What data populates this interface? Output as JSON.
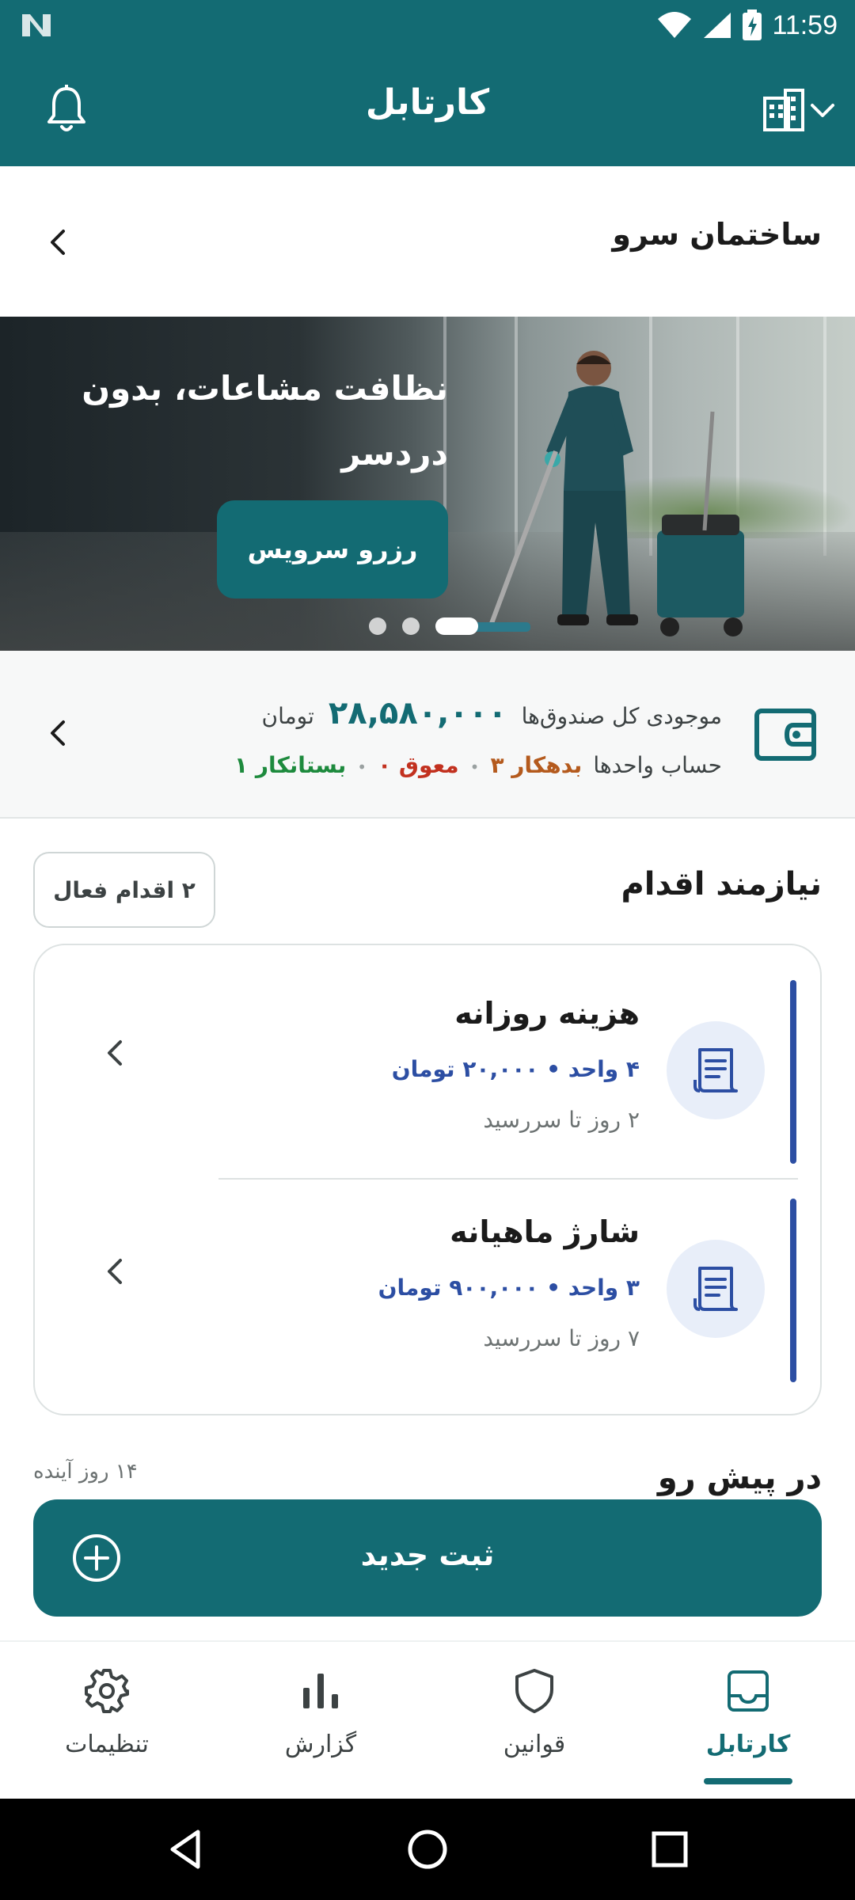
{
  "status_bar": {
    "time": "11:59",
    "icons": [
      "wifi-icon",
      "signal-icon",
      "battery-icon",
      "notification-n-icon"
    ]
  },
  "app_bar": {
    "title": "کارتابل",
    "icons": [
      "bell-icon",
      "building-icon",
      "chevron-down-icon"
    ]
  },
  "building": {
    "name": "ساختمان سرو"
  },
  "banner": {
    "title": "نظافت مشاعات، بدون دردسر",
    "cta": "رزرو سرویس",
    "slides": 3,
    "active_slide": 1
  },
  "balance": {
    "label": "موجودی کل صندوق‌ها",
    "amount": "۲۸,۵۸۰,۰۰۰",
    "currency": "تومان",
    "accounts_label": "حساب واحدها",
    "debtor": "۳ بدهکار",
    "overdue": "۰ معوق",
    "creditor": "۱ بستانکار",
    "colors": {
      "debtor": "#b45a1d",
      "overdue": "#c2311f",
      "creditor": "#1d8a3d"
    }
  },
  "action_needed": {
    "title": "نیازمند اقدام",
    "badge": "۲ اقدام فعال",
    "items": [
      {
        "name": "هزینه روزانه",
        "meta": "۴ واحد • ۲۰,۰۰۰ تومان",
        "due": "۲ روز تا سررسید",
        "icon": "receipt-icon"
      },
      {
        "name": "شارژ ماهیانه",
        "meta": "۳ واحد • ۹۰۰,۰۰۰ تومان",
        "due": "۷ روز تا سررسید",
        "icon": "receipt-icon"
      }
    ]
  },
  "upcoming": {
    "title": "در پیش رو",
    "hint": "۱۴ روز آینده"
  },
  "new_entry": {
    "label": "ثبت جدید"
  },
  "bottom_nav": {
    "items": [
      {
        "label": "کارتابل",
        "icon": "inbox-icon",
        "active": true
      },
      {
        "label": "قوانین",
        "icon": "shield-icon",
        "active": false
      },
      {
        "label": "گزارش",
        "icon": "bar-chart-icon",
        "active": false
      },
      {
        "label": "تنظیمات",
        "icon": "gear-icon",
        "active": false
      }
    ]
  },
  "colors": {
    "primary": "#136b73",
    "accent_blue": "#2c4ea3"
  }
}
